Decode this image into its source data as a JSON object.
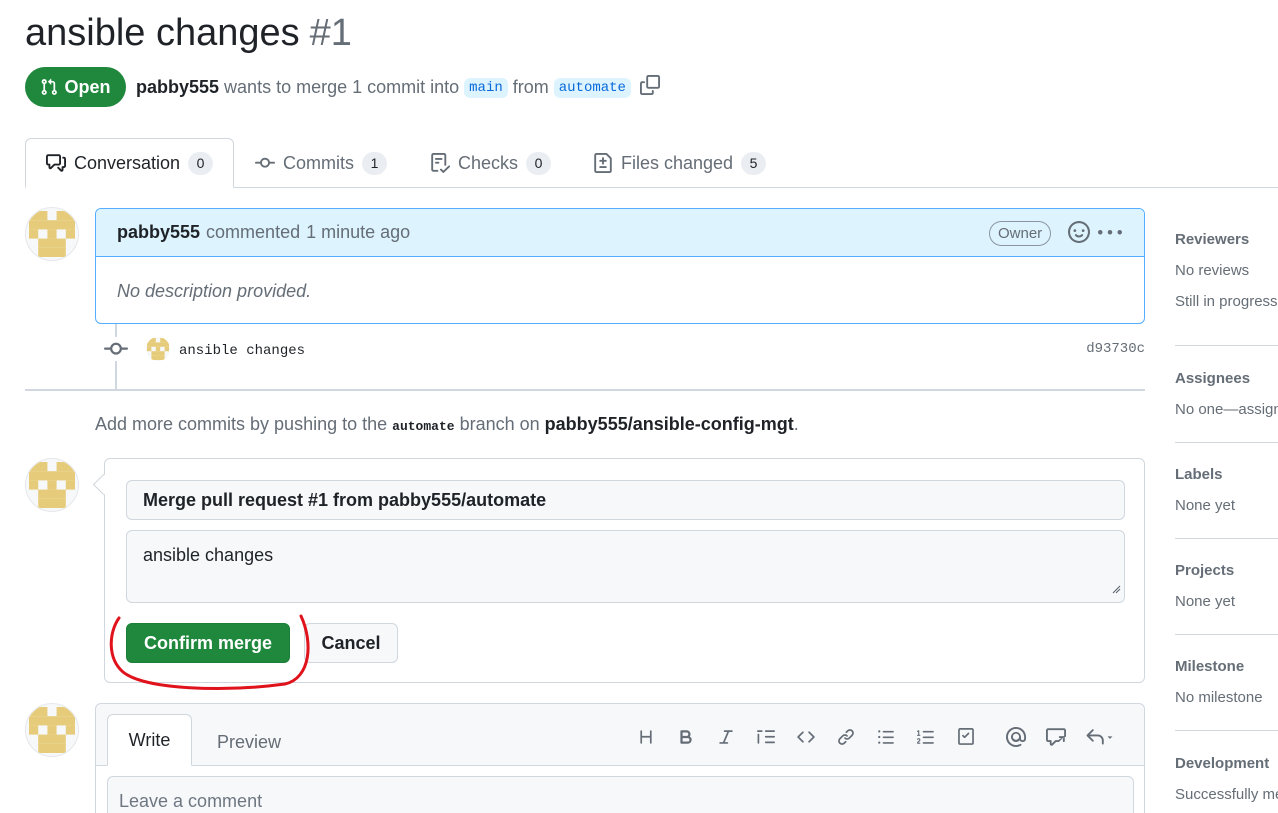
{
  "pr": {
    "title": "ansible changes",
    "number": "#1",
    "status": "Open",
    "author": "pabby555",
    "merge_text": "wants to merge 1 commit into",
    "base_branch": "main",
    "from_text": "from",
    "head_branch": "automate"
  },
  "tabs": [
    {
      "label": "Conversation",
      "count": "0"
    },
    {
      "label": "Commits",
      "count": "1"
    },
    {
      "label": "Checks",
      "count": "0"
    },
    {
      "label": "Files changed",
      "count": "5"
    }
  ],
  "comment": {
    "author": "pabby555",
    "action": "commented",
    "time": "1 minute ago",
    "role": "Owner",
    "body": "No description provided."
  },
  "commit": {
    "message": "ansible changes",
    "sha": "d93730c"
  },
  "push_hint": {
    "prefix": "Add more commits by pushing to the",
    "branch": "automate",
    "middle": "branch on",
    "repo": "pabby555/ansible-config-mgt",
    "suffix": "."
  },
  "merge": {
    "title_value": "Merge pull request #1 from pabby555/automate",
    "message_value": "ansible changes",
    "confirm_label": "Confirm merge",
    "cancel_label": "Cancel",
    "highlight_color": "#e0121b"
  },
  "composer": {
    "write_tab": "Write",
    "preview_tab": "Preview",
    "placeholder": "Leave a comment",
    "tools": [
      "heading-icon",
      "bold-icon",
      "italic-icon",
      "quote-icon",
      "code-icon",
      "link-icon",
      "unordered-list-icon",
      "ordered-list-icon",
      "task-list-icon",
      "mention-icon",
      "reference-icon",
      "reply-icon"
    ]
  },
  "sidebar": {
    "reviewers": {
      "title": "Reviewers",
      "values": [
        "No reviews",
        "Still in progress?"
      ]
    },
    "assignees": {
      "title": "Assignees",
      "value": "No one—assign yourself"
    },
    "labels": {
      "title": "Labels",
      "value": "None yet"
    },
    "projects": {
      "title": "Projects",
      "value": "None yet"
    },
    "milestone": {
      "title": "Milestone",
      "value": "No milestone"
    },
    "development": {
      "title": "Development",
      "value": "Successfully merging"
    }
  },
  "colors": {
    "success": "#1f883d",
    "accent_blue": "#0969da",
    "comment_header": "#ddf4ff",
    "avatar_identicon": "#e6cc7a"
  }
}
